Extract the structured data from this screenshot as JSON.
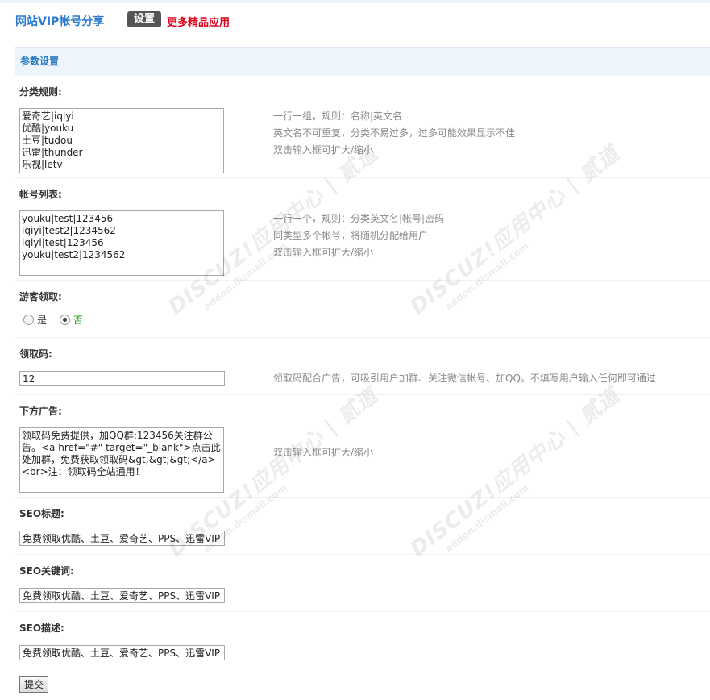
{
  "header": {
    "app_title": "网站VIP帐号分享",
    "tab_setting": "设置",
    "more_link": "更多精品应用"
  },
  "section": {
    "title": "参数设置"
  },
  "fields": {
    "category_rules": {
      "label": "分类规则:",
      "value": "爱奇艺|iqiyi\n优酷|youku\n土豆|tudou\n迅雷|thunder\n乐视|letv",
      "tips": [
        "一行一组，规则：名称|英文名",
        "英文名不可重复，分类不易过多，过多可能效果显示不佳",
        "双击输入框可扩大/缩小"
      ]
    },
    "account_list": {
      "label": "帐号列表:",
      "value": "youku|test|123456\niqiyi|test2|1234562\niqiyi|test|123456\nyouku|test2|1234562",
      "tips": [
        "一行一个，规则：分类英文名|帐号|密码",
        "同类型多个帐号，将随机分配给用户",
        "双击输入框可扩大/缩小"
      ]
    },
    "guest_claim": {
      "label": "游客领取:",
      "options": [
        {
          "label": "是",
          "selected": false
        },
        {
          "label": "否",
          "selected": true
        }
      ]
    },
    "claim_code": {
      "label": "领取码:",
      "value": "12",
      "tip": "领取码配合广告，可吸引用户加群、关注微信帐号、加QQ。不填写用户输入任何即可通过"
    },
    "bottom_ad": {
      "label": "下方广告:",
      "value": "领取码免费提供，加QQ群:123456关注群公告。<a href=\"#\" target=\"_blank\">点击此处加群，免费获取领取码&gt;&gt;&gt;</a>\n<br>注：领取码全站通用！",
      "tip": "双击输入框可扩大/缩小"
    },
    "seo_title": {
      "label": "SEO标题:",
      "value": "免费领取优酷、土豆、爱奇艺、PPS、迅雷VIP"
    },
    "seo_keywords": {
      "label": "SEO关键词:",
      "value": "免费领取优酷、土豆、爱奇艺、PPS、迅雷VIP"
    },
    "seo_description": {
      "label": "SEO描述:",
      "value": "免费领取优酷、土豆、爱奇艺、PPS、迅雷VIP"
    }
  },
  "submit_label": "提交",
  "watermark": {
    "brand": "DISCUZ!应用中心 | 贰道",
    "url": "addon.dismall.com"
  }
}
